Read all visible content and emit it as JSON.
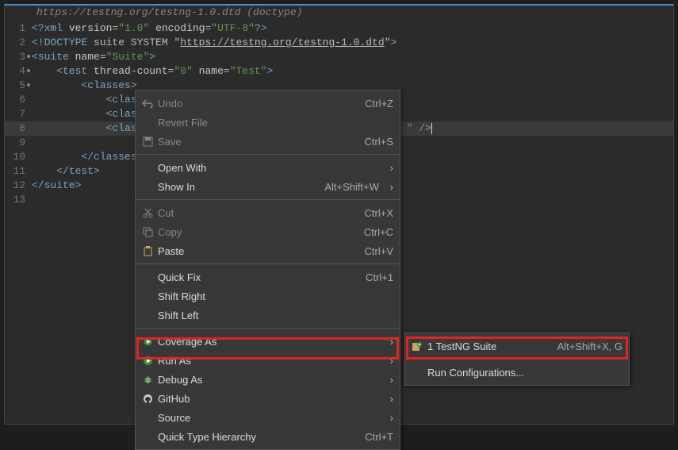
{
  "breadcrumb": "https://testng.org/testng-1.0.dtd (doctype)",
  "code": {
    "l1_a": "<?",
    "l1_b": "xml",
    "l1_c": " version",
    "l1_d": "=",
    "l1_e": "\"1.0\"",
    "l1_f": " encoding",
    "l1_g": "=",
    "l1_h": "\"UTF-8\"",
    "l1_i": "?>",
    "l2_a": "<!",
    "l2_b": "DOCTYPE",
    "l2_c": " suite SYSTEM ",
    "l2_d": "\"",
    "l2_link": "https://testng.org/testng-1.0.dtd",
    "l2_e": "\"",
    "l2_f": ">",
    "l3_a": "<",
    "l3_b": "suite",
    "l3_c": " name",
    "l3_d": "=",
    "l3_e": "\"Suite\"",
    "l3_f": ">",
    "l4_a": "    <",
    "l4_b": "test",
    "l4_c": " thread-count",
    "l4_d": "=",
    "l4_e": "\"0\"",
    "l4_f": " name",
    "l4_g": "=",
    "l4_h": "\"Test\"",
    "l4_i": ">",
    "l5_a": "        <",
    "l5_b": "classes",
    "l5_c": ">",
    "l6_a": "            <",
    "l6_b": "clas",
    "l7_a": "            <",
    "l7_b": "clas",
    "l8_a": "            <",
    "l8_b": "clas",
    "l8_c": "\"",
    "l8_d": " />",
    "l9_a": "",
    "l10_a": "        </",
    "l10_b": "classes",
    "l10_c": ">",
    "l11_a": "    </",
    "l11_b": "test",
    "l11_c": ">",
    "l12_a": "</",
    "l12_b": "suite",
    "l12_c": ">"
  },
  "gutter": {
    "n1": "1",
    "n2": "2",
    "n3": "3",
    "n4": "4",
    "n5": "5",
    "n6": "6",
    "n7": "7",
    "n8": "8",
    "n9": "9",
    "n10": "10",
    "n11": "11",
    "n12": "12",
    "n13": "13"
  },
  "menu": {
    "undo": "Undo",
    "undo_sc": "Ctrl+Z",
    "revert": "Revert File",
    "save": "Save",
    "save_sc": "Ctrl+S",
    "openwith": "Open With",
    "showin": "Show In",
    "showin_sc": "Alt+Shift+W",
    "cut": "Cut",
    "cut_sc": "Ctrl+X",
    "copy": "Copy",
    "copy_sc": "Ctrl+C",
    "paste": "Paste",
    "paste_sc": "Ctrl+V",
    "quickfix": "Quick Fix",
    "quickfix_sc": "Ctrl+1",
    "shiftright": "Shift Right",
    "shiftleft": "Shift Left",
    "coverage": "Coverage As",
    "runas": "Run As",
    "debugas": "Debug As",
    "github": "GitHub",
    "source": "Source",
    "qth": "Quick Type Hierarchy",
    "qth_sc": "Ctrl+T"
  },
  "submenu": {
    "testng": "1 TestNG Suite",
    "testng_sc": "Alt+Shift+X, G",
    "runconf": "Run Configurations..."
  },
  "arrow": "›"
}
